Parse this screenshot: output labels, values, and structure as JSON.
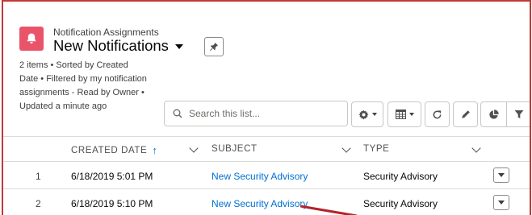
{
  "header": {
    "object_label": "Notification Assignments",
    "title": "New Notifications",
    "icon": "bell-icon",
    "accent_color": "#e9546a"
  },
  "list_info": "2 items • Sorted by Created Date • Filtered by my notification assignments - Read by Owner • Updated a minute ago",
  "search": {
    "placeholder": "Search this list..."
  },
  "toolbar": {
    "buttons": [
      "settings-gear-icon",
      "table-view-icon",
      "refresh-icon",
      "edit-pencil-icon",
      "chart-icon",
      "filter-icon"
    ]
  },
  "table": {
    "columns": {
      "created_date": "CREATED DATE",
      "subject": "SUBJECT",
      "type": "TYPE"
    },
    "sort_indicator": "↑",
    "rows": [
      {
        "num": "1",
        "created_date": "6/18/2019 5:01 PM",
        "subject": "New Security Advisory",
        "type": "Security Advisory"
      },
      {
        "num": "2",
        "created_date": "6/18/2019 5:10 PM",
        "subject": "New Security Advisory",
        "type": "Security Advisory"
      }
    ]
  },
  "colors": {
    "frame_border": "#c23934",
    "link": "#0070d2"
  }
}
